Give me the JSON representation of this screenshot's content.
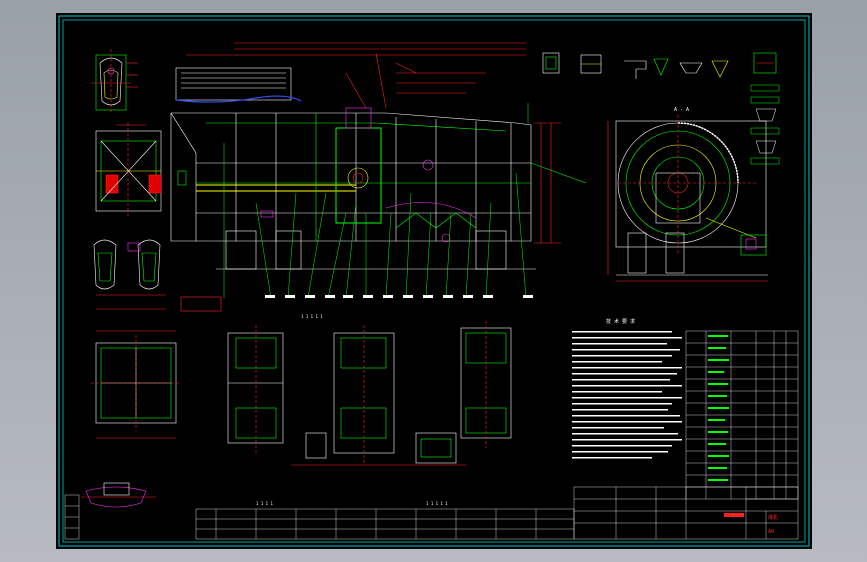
{
  "drawing": {
    "section_label": "A - A",
    "notes_title": "技 术 要 求",
    "dim_horizontal": "1 1 1 1 1",
    "dim_bottom_left": "1 1 1 1",
    "dim_bottom_mid": "1 1 1 1 1",
    "title_block_name": "煤机",
    "title_block_code": "A0"
  },
  "colors": {
    "frame": "#00c8c8",
    "lines": "#ffffff",
    "primary": "#00ff00",
    "dims": "#ff2020",
    "accent": "#ffff00",
    "blue": "#3050ff",
    "magenta": "#ff30ff"
  }
}
